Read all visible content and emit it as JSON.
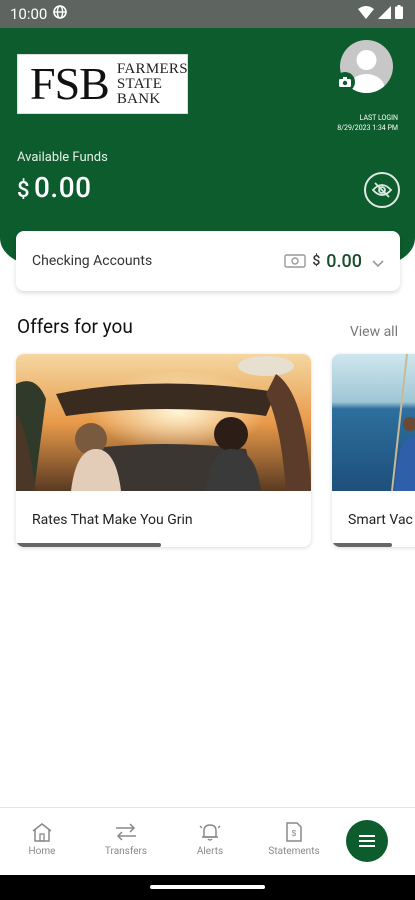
{
  "status": {
    "time": "10:00"
  },
  "bank": {
    "logo_initials": "FSB",
    "logo_name_lines": [
      "Farmers",
      "State",
      "Bank"
    ]
  },
  "profile": {
    "last_login_label": "LAST LOGIN",
    "last_login_value": "8/29/2023 1:34 PM"
  },
  "funds": {
    "label": "Available Funds",
    "currency": "$",
    "amount": "0.00"
  },
  "account": {
    "label": "Checking Accounts",
    "currency": "$",
    "amount": "0.00"
  },
  "offers": {
    "title": "Offers for you",
    "view_all": "View all",
    "items": [
      {
        "caption": "Rates That Make You Grin"
      },
      {
        "caption": "Smart Vac"
      }
    ]
  },
  "nav": {
    "items": [
      {
        "label": "Home",
        "icon": "home-icon"
      },
      {
        "label": "Transfers",
        "icon": "transfers-icon"
      },
      {
        "label": "Alerts",
        "icon": "bell-icon"
      },
      {
        "label": "Statements",
        "icon": "statement-icon"
      }
    ],
    "menu_icon": "menu-icon"
  },
  "colors": {
    "brand_green": "#0d5c2e",
    "status_bar": "#5e6560"
  }
}
